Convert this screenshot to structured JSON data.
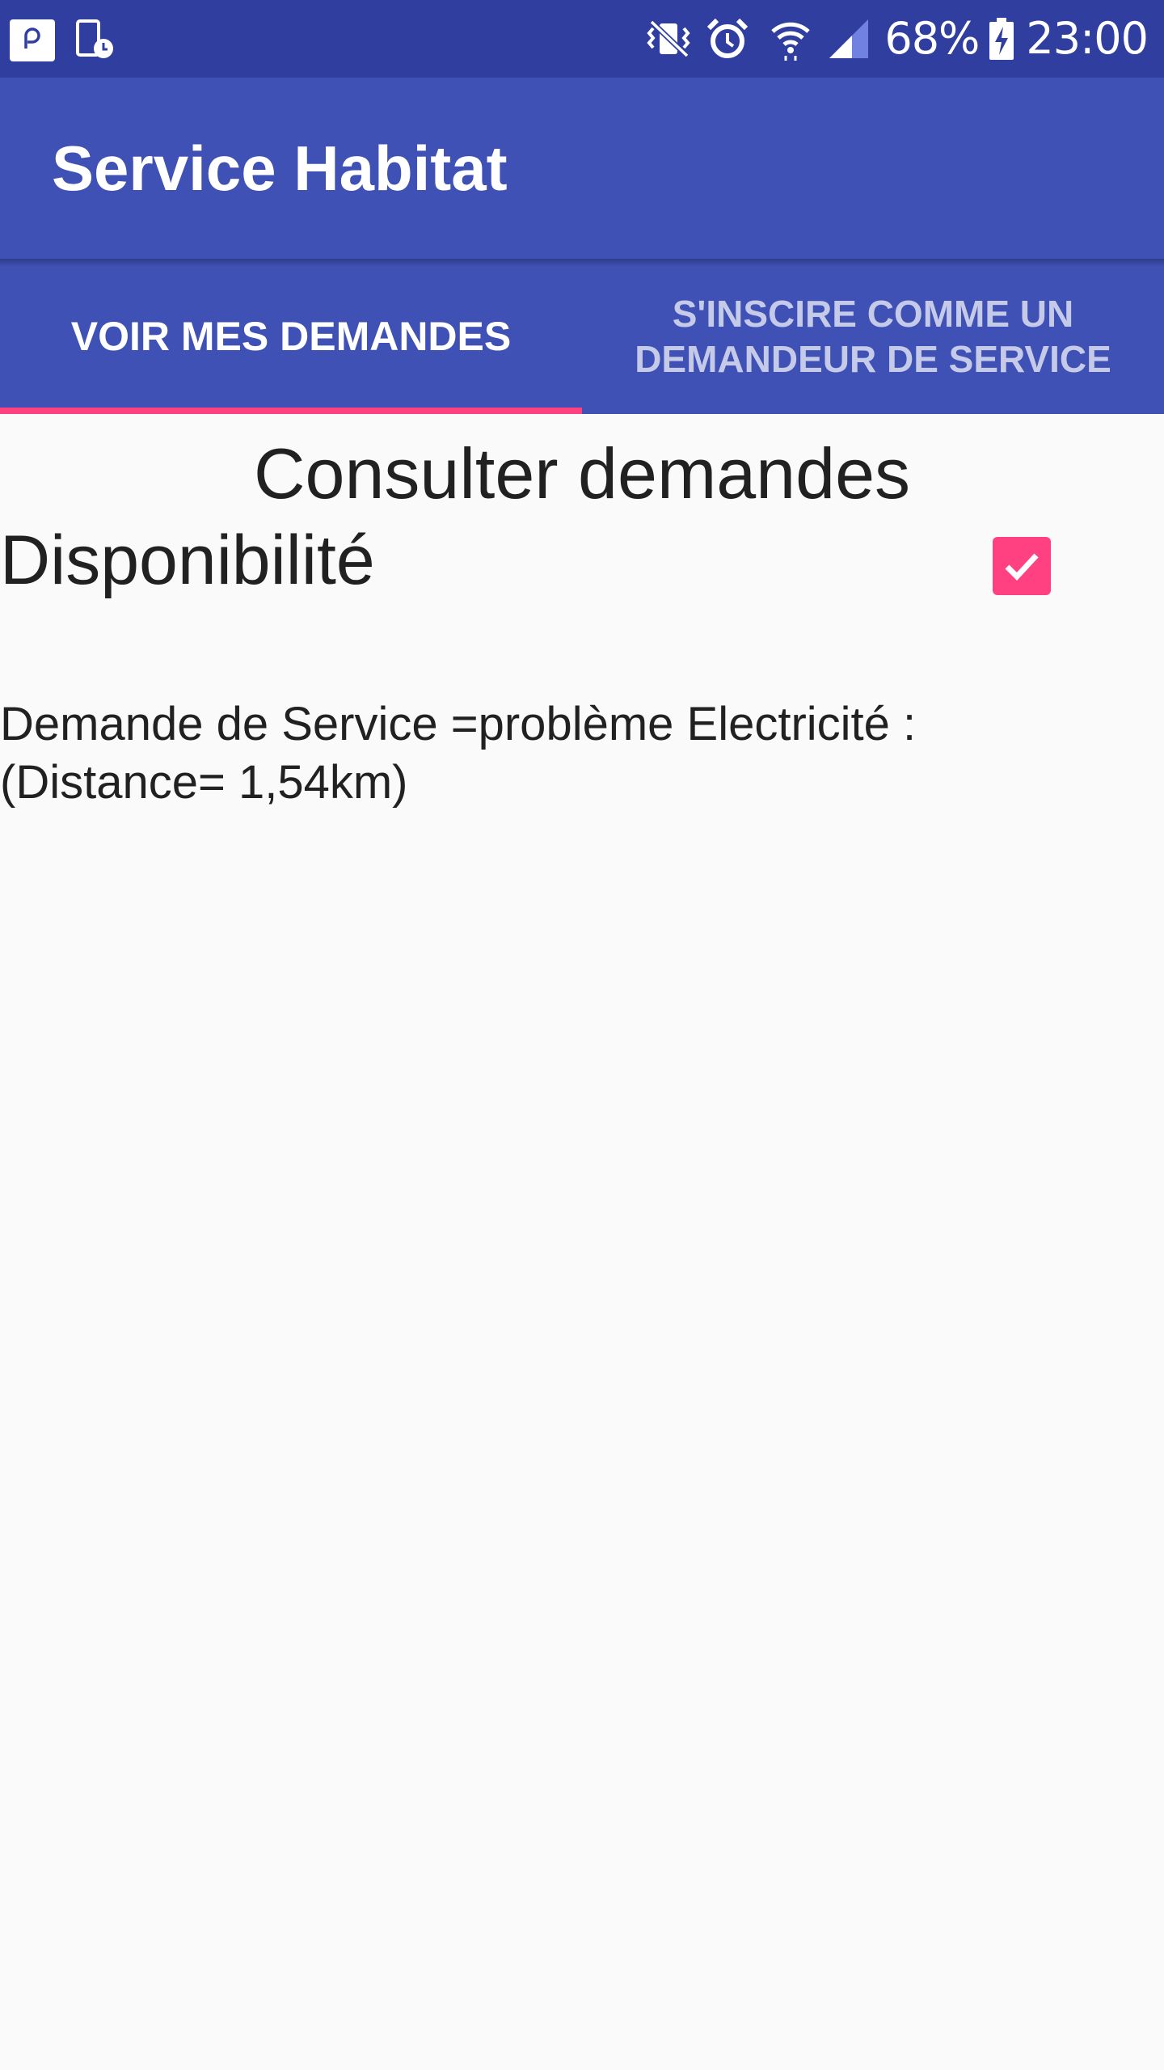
{
  "status_bar": {
    "battery": "68%",
    "time": "23:00",
    "icons": [
      "app-notification-icon",
      "screen-schedule-icon",
      "vibrate-mute-icon",
      "alarm-icon",
      "wifi-icon",
      "signal-icon",
      "battery-charging-icon"
    ]
  },
  "app_bar": {
    "title": "Service Habitat"
  },
  "tabs": [
    {
      "label": "VOIR MES DEMANDES",
      "active": true
    },
    {
      "label": "S'INSCIRE COMME UN\nDEMANDEUR DE SERVICE",
      "active": false
    }
  ],
  "main": {
    "heading": "Consulter demandes",
    "availability_label": "Disponibilité",
    "availability_checked": true,
    "requests": [
      {
        "text": "Demande de Service =problème Electricité  :\n(Distance= 1,54km)"
      }
    ]
  },
  "colors": {
    "status_bar": "#303f9f",
    "primary": "#3f51b5",
    "accent": "#ff4081",
    "background": "#fafafa",
    "text": "#212121"
  }
}
